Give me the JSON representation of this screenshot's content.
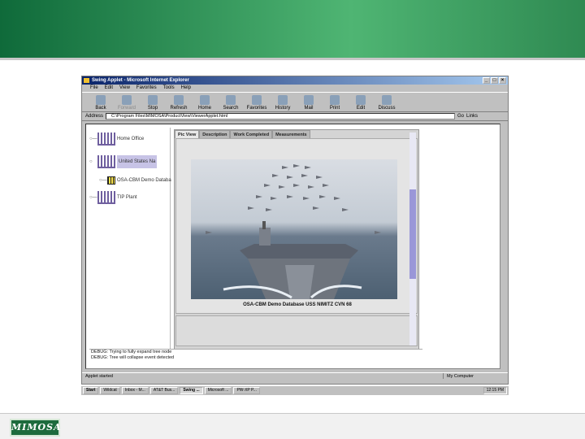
{
  "browser": {
    "title": "Swing Applet - Microsoft Internet Explorer",
    "menu": [
      "File",
      "Edit",
      "View",
      "Favorites",
      "Tools",
      "Help"
    ],
    "toolbar": [
      "Back",
      "Forward",
      "Stop",
      "Refresh",
      "Home",
      "Search",
      "Favorites",
      "History",
      "Mail",
      "Print",
      "Edit",
      "Discuss"
    ],
    "address_label": "Address",
    "address_value": "C:\\Program Files\\MIMOSA\\ProductView\\ViewerApplet.html",
    "go_label": "Go",
    "links_label": "Links"
  },
  "tree": {
    "items": [
      {
        "label": "Home Office",
        "handle": "○—"
      },
      {
        "label": "United States Na",
        "handle": "○"
      },
      {
        "label": "OSA-CBM Demo Databa",
        "handle": "○—"
      },
      {
        "label": "TIP Plant",
        "handle": "○—"
      }
    ]
  },
  "tabs": [
    "Pic View",
    "Description",
    "Work Completed",
    "Measurements"
  ],
  "picture": {
    "caption": "OSA-CBM Demo Database USS NIMITZ CVN 68"
  },
  "console": {
    "lines": [
      "DEBUG: Trying to fully expand tree node",
      "DEBUG: Tree will collapse event detected"
    ]
  },
  "status": {
    "left": "Applet started",
    "right": "My Computer"
  },
  "taskbar": {
    "items": [
      "Start",
      "Wildcat",
      "Inbox - M...",
      "AT&T Bus...",
      "Swing ...",
      "Microsoft ...",
      "PW-XP P..."
    ],
    "clock": "12:15 PM"
  },
  "footer": {
    "logo_text": "MIMOSA"
  },
  "colors": {
    "banner_start": "#0f6a3a",
    "banner_mid": "#4fb573",
    "tree_chart": "#6f5f9f",
    "scroll_thumb": "#9a97d8"
  }
}
